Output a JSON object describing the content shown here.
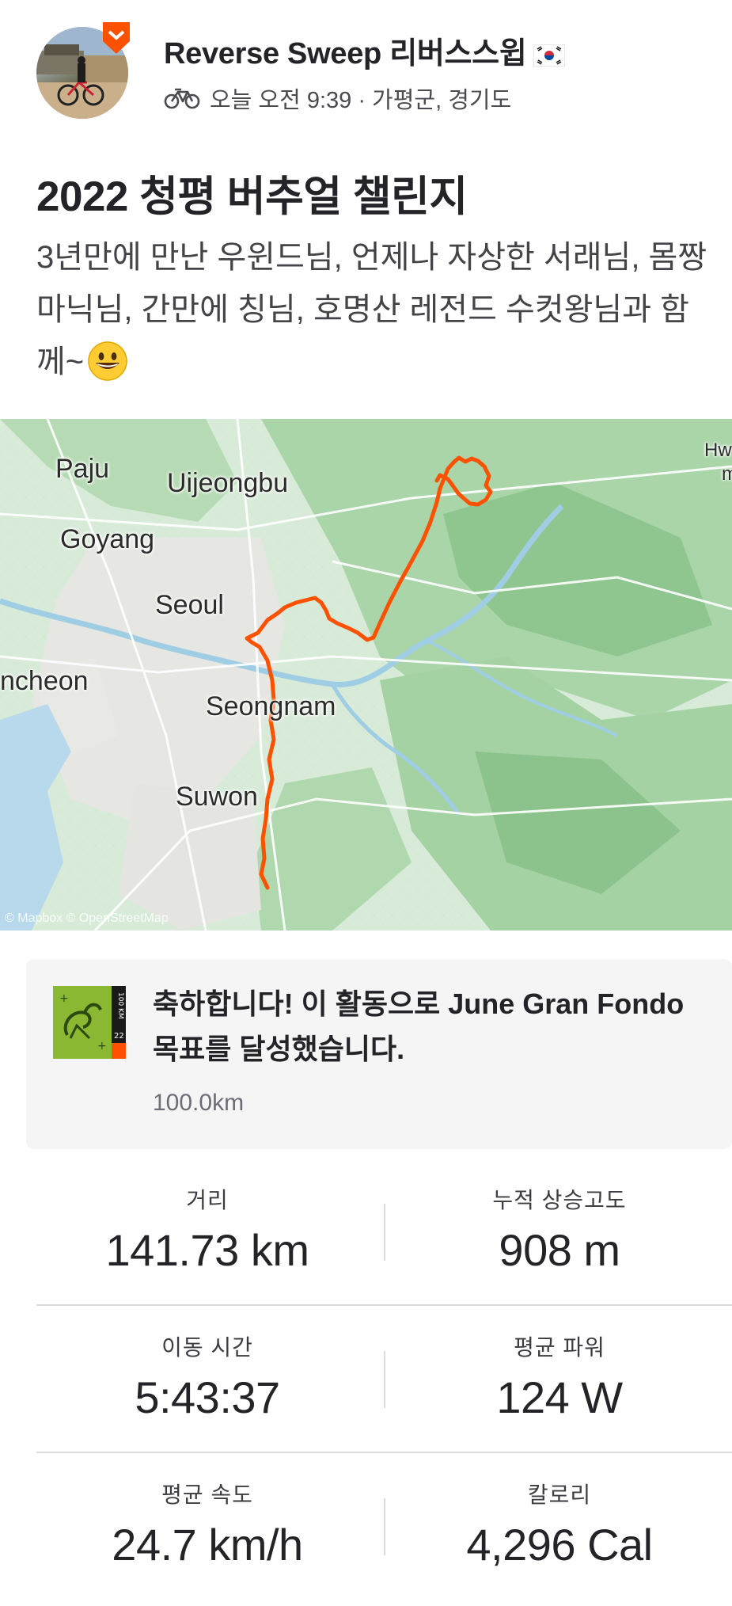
{
  "athlete": {
    "name": "Reverse Sweep 리버스스윕",
    "flag": "flag-south-korea",
    "activity_icon": "bike-icon",
    "meta": "오늘 오전 9:39 · 가평군, 경기도"
  },
  "activity": {
    "title": "2022 청평 버추얼 챌린지",
    "description": "3년만에 만난 우윈드님, 언제나 자상한 서래님, 몸짱 마닉님, 간만에 칭님, 호명산 레전드 수컷왕님과 함께~",
    "description_emoji": "grinning-face-emoji"
  },
  "map": {
    "cities": [
      "Paju",
      "Uijeongbu",
      "Goyang",
      "Seoul",
      "ncheon",
      "Seongnam",
      "Suwon",
      "Hw",
      "m"
    ],
    "attribution": "© Mapbox © OpenStreetMap",
    "route_color": "#fc5200"
  },
  "achievement": {
    "badge_icon": "gran-fondo-badge-icon",
    "badge_text_top": "100 KM",
    "badge_text_bottom": "22",
    "text": "축하합니다! 이 활동으로 June Gran Fondo 목표를 달성했습니다.",
    "detail": "100.0km"
  },
  "stats": [
    {
      "left_label": "거리",
      "left_value": "141.73 km",
      "right_label": "누적 상승고도",
      "right_value": "908 m"
    },
    {
      "left_label": "이동 시간",
      "left_value": "5:43:37",
      "right_label": "평균 파워",
      "right_value": "124 W"
    },
    {
      "left_label": "평균 속도",
      "left_value": "24.7 km/h",
      "right_label": "칼로리",
      "right_value": "4,296 Cal"
    }
  ]
}
